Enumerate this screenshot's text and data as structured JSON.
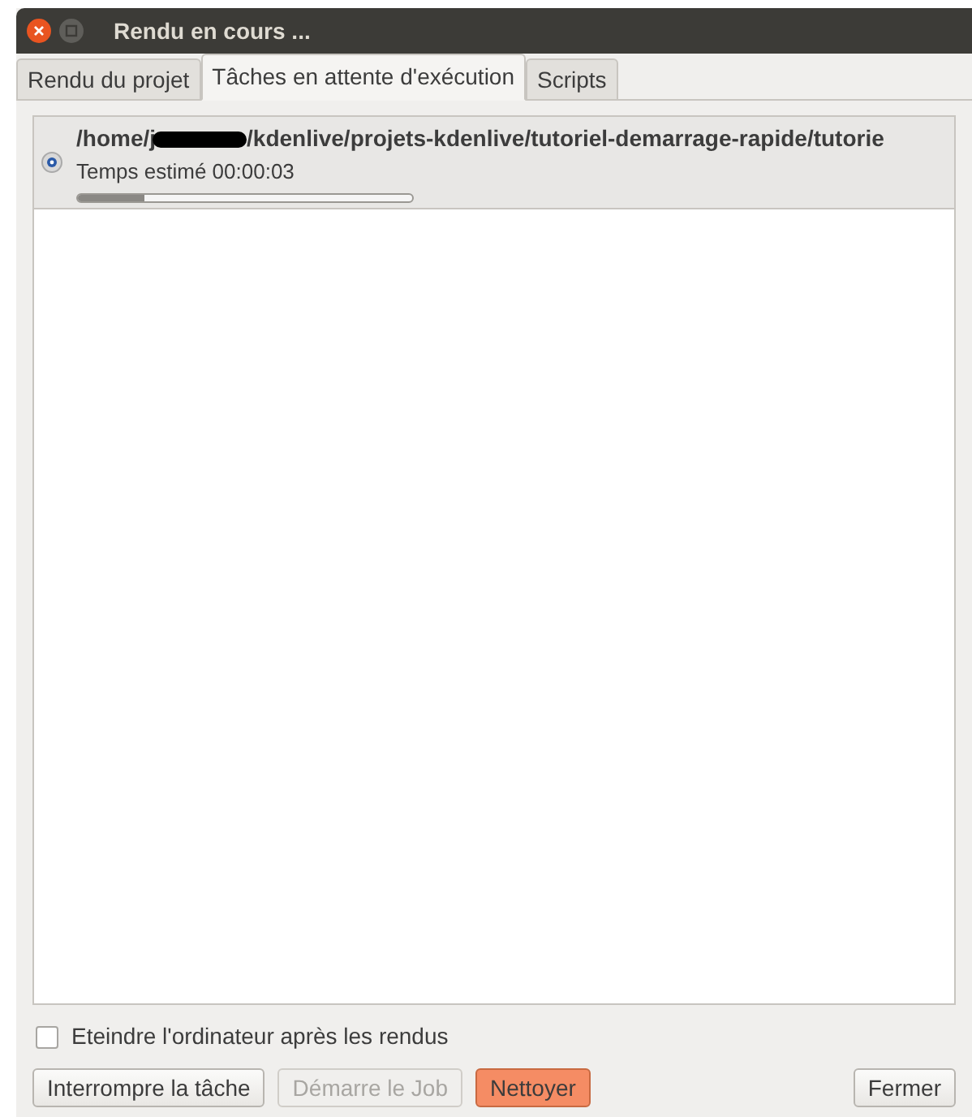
{
  "window": {
    "title": "Rendu en cours ..."
  },
  "tabs": [
    {
      "label": "Rendu du projet",
      "selected": false
    },
    {
      "label": "Tâches en attente d'exécution",
      "selected": true
    },
    {
      "label": "Scripts",
      "selected": false
    }
  ],
  "jobs": [
    {
      "path_start": "/home/j",
      "redacted": true,
      "path_end": "/kdenlive/projets-kdenlive/tutoriel-demarrage-rapide/tutorie",
      "status": "Temps estimé 00:00:03",
      "level": 0.2,
      "selected": true
    }
  ],
  "shutdown_option": {
    "label": "Eteindre l'ordinateur après les rendus",
    "checked": false
  },
  "buttons": [
    {
      "label": "Interrompre la tâche",
      "disabled": false,
      "highlighted": false
    },
    {
      "label": "Démarre le Job",
      "disabled": true,
      "highlighted": false
    },
    {
      "label": "Nettoyer",
      "disabled": false,
      "highlighted": true
    },
    {
      "label": "Fermer",
      "disabled": false,
      "highlighted": false
    }
  ]
}
